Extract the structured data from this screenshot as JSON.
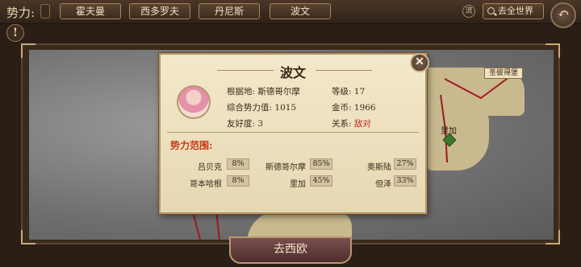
{
  "topbar": {
    "faction_label": "势力:",
    "tabs": [
      "霍夫曼",
      "西多罗夫",
      "丹尼斯",
      "波文"
    ],
    "flow_icon_text": "流",
    "go_world_label": "去全世界"
  },
  "map": {
    "city_flag": "圣彼得堡",
    "city_label": "里加",
    "go_europe_label": "去西欧"
  },
  "panel": {
    "title": "波文",
    "base_label": "根据地:",
    "base_value": "斯德哥尔摩",
    "power_label": "综合势力值:",
    "power_value": "1015",
    "favor_label": "友好度:",
    "favor_value": "3",
    "level_label": "等级:",
    "level_value": "17",
    "gold_label": "金币:",
    "gold_value": "1966",
    "relation_label": "关系:",
    "relation_value": "敌对",
    "range_heading": "势力范围:",
    "territories": [
      {
        "name": "吕贝克",
        "pct": "8%"
      },
      {
        "name": "斯德哥尔摩",
        "pct": "85%"
      },
      {
        "name": "奥斯陆",
        "pct": "27%"
      },
      {
        "name": "哥本哈根",
        "pct": "8%"
      },
      {
        "name": "里加",
        "pct": "45%"
      },
      {
        "name": "但泽",
        "pct": "33%"
      }
    ]
  },
  "colors": {
    "accent_red": "#c3261c",
    "panel_bg": "#f3e8cb",
    "tab_bg": "#4a3626"
  }
}
